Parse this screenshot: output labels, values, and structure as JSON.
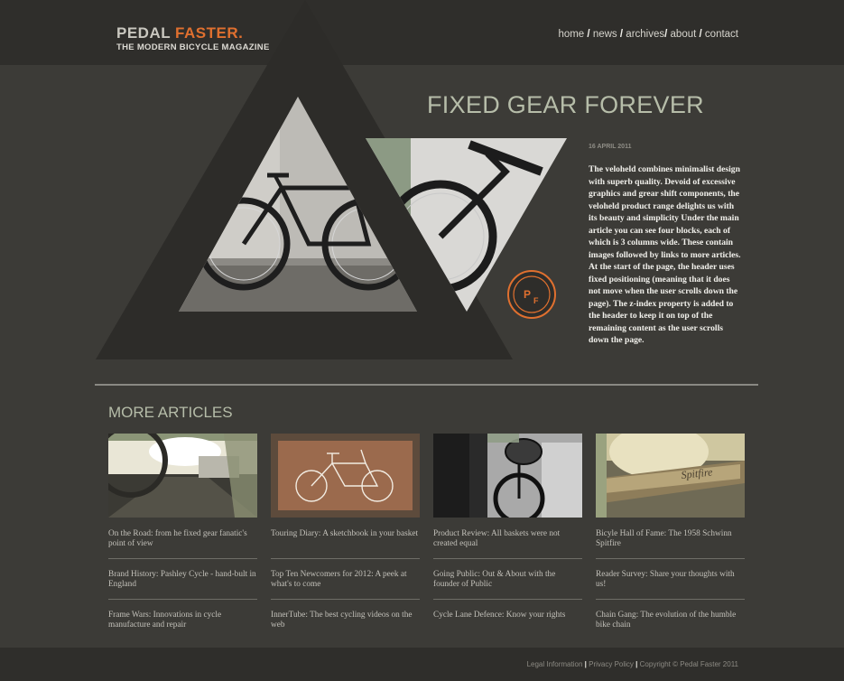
{
  "site": {
    "name_part1": "PEDAL",
    "name_part2": "FASTER.",
    "tagline": "THE MODERN BICYCLE MAGAZINE"
  },
  "nav": {
    "items": [
      "home",
      "news",
      "archives",
      "about",
      "contact"
    ],
    "separators": [
      "/",
      "/",
      "/",
      "/"
    ]
  },
  "feature": {
    "title": "FIXED GEAR FOREVER",
    "date": "16 APRIL 2011",
    "badge": "PF",
    "body": "The veloheld combines minimalist design with superb quality. Devoid of excessive graphics and grear shift components, the veloheld product range delights us with its beauty and simplicity Under the main article you can see four blocks, each of which is 3 columns wide. These contain images followed by links to more articles. At the start of the page, the header uses fixed positioning (meaning that it does not move when the user scrolls down the page). The z-index property is added to the header to keep it on top of the remaining content as the user scrolls down the page."
  },
  "more_articles": {
    "heading": "MORE ARTICLES",
    "columns": [
      {
        "image": "road-photo",
        "links": [
          "On the Road: from he fixed gear fanatic's point of view",
          "Brand History: Pashley Cycle - hand-bult in England",
          "Frame Wars: Innovations in cycle manufacture and repair"
        ]
      },
      {
        "image": "bicycle-sketch",
        "links": [
          "Touring Diary: A sketchbook in your basket",
          "Top Ten Newcomers for 2012: A peek at what's to come",
          "InnerTube: The best cycling videos on the web"
        ]
      },
      {
        "image": "basket-photo",
        "links": [
          "Product Review: All baskets were not created equal",
          "Going Public: Out & About with the founder of Public",
          "Cycle Lane Defence: Know your rights"
        ]
      },
      {
        "image": "spitfire-photo",
        "links": [
          "Bicyle Hall of Fame: The 1958 Schwinn Spitfire",
          "Reader Survey: Share your thoughts with us!",
          "Chain Gang: The evolution of the humble bike chain"
        ]
      }
    ]
  },
  "footer": {
    "links": [
      "Legal Information",
      "Privacy Policy",
      "Copyright © Pedal Faster 2011"
    ],
    "separators": [
      "|",
      "|"
    ]
  },
  "colors": {
    "background": "#3c3b37",
    "header_bar": "#2f2e2b",
    "accent_orange": "#e0702f",
    "heading_sage": "#b6bda9"
  }
}
